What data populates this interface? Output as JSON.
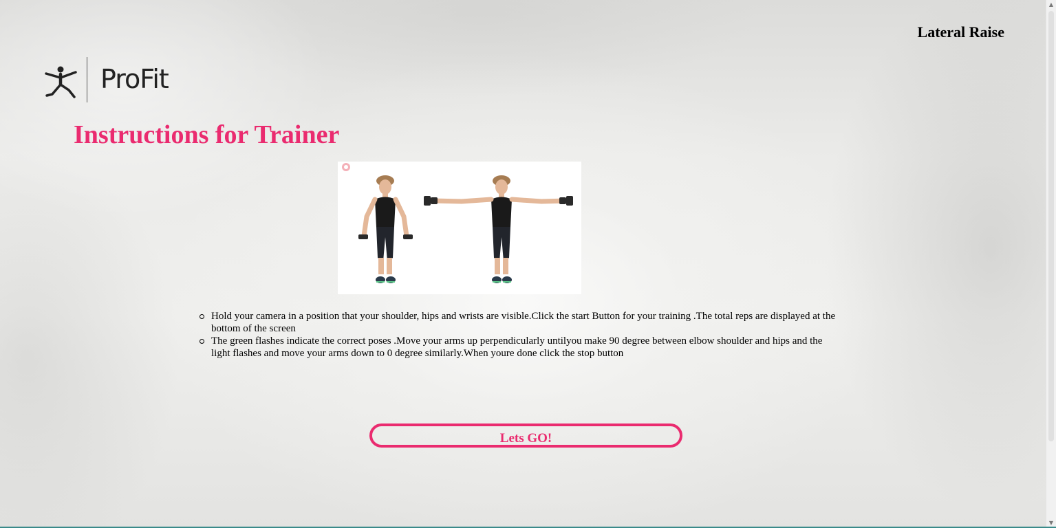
{
  "header": {
    "exercise_name": "Lateral Raise"
  },
  "brand": {
    "logo_text": "ProFit",
    "logo_icon": "yoga-figure-icon"
  },
  "main": {
    "heading": "Instructions for Trainer",
    "image_alt": "lateral raise demonstration",
    "instructions": [
      "Hold your camera in a position that your shoulder, hips and wrists are visible.Click the start Button for your training .The total reps are displayed at the bottom of the screen",
      "The green flashes indicate the correct poses .Move your arms up perpendicularly untilyou make 90 degree between elbow shoulder and hips and the light flashes and move your arms down to 0 degree similarly.When youre done click the stop button"
    ],
    "start_button_label": "Lets GO!"
  },
  "colors": {
    "accent": "#ea2b6f",
    "text": "#000000"
  }
}
